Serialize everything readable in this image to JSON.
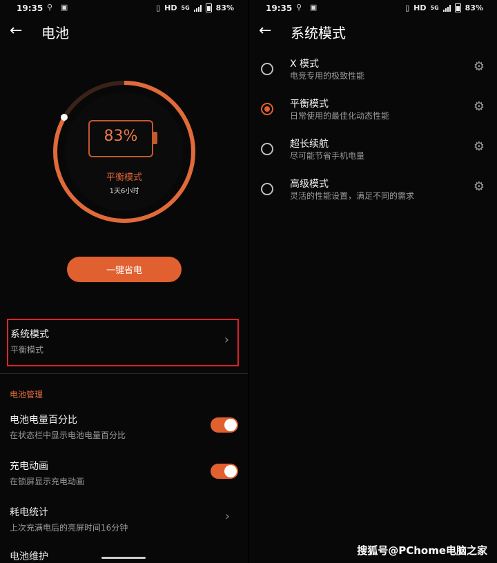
{
  "left": {
    "status": {
      "time": "19:35",
      "net": "HD",
      "gen": "5G",
      "battery": "83%"
    },
    "header": {
      "title": "电池"
    },
    "battery": {
      "percent": "83%",
      "mode": "平衡模式",
      "remaining": "1天6小时",
      "level": 0.83
    },
    "save_button": "一键省电",
    "system_mode": {
      "title": "系统模式",
      "value": "平衡模式"
    },
    "section_title": "电池管理",
    "items": [
      {
        "title": "电池电量百分比",
        "subtitle": "在状态栏中显示电池电量百分比",
        "toggle": true
      },
      {
        "title": "充电动画",
        "subtitle": "在锁屏显示充电动画",
        "toggle": true
      },
      {
        "title": "耗电统计",
        "subtitle": "上次充满电后的亮屏时间16分钟"
      },
      {
        "title": "电池维护"
      }
    ]
  },
  "right": {
    "status": {
      "time": "19:35",
      "net": "HD",
      "gen": "5G",
      "battery": "83%"
    },
    "header": {
      "title": "系统模式"
    },
    "options": [
      {
        "title": "X 模式",
        "subtitle": "电竞专用的极致性能",
        "selected": false
      },
      {
        "title": "平衡模式",
        "subtitle": "日常使用的最佳化动态性能",
        "selected": true
      },
      {
        "title": "超长续航",
        "subtitle": "尽可能节省手机电量",
        "selected": false
      },
      {
        "title": "高级模式",
        "subtitle": "灵活的性能设置，满足不同的需求",
        "selected": false
      }
    ]
  },
  "watermark": "搜狐号@PChome电脑之家",
  "colors": {
    "accent": "#e0602f",
    "highlight_border": "#e0202a",
    "background": "#080808"
  }
}
